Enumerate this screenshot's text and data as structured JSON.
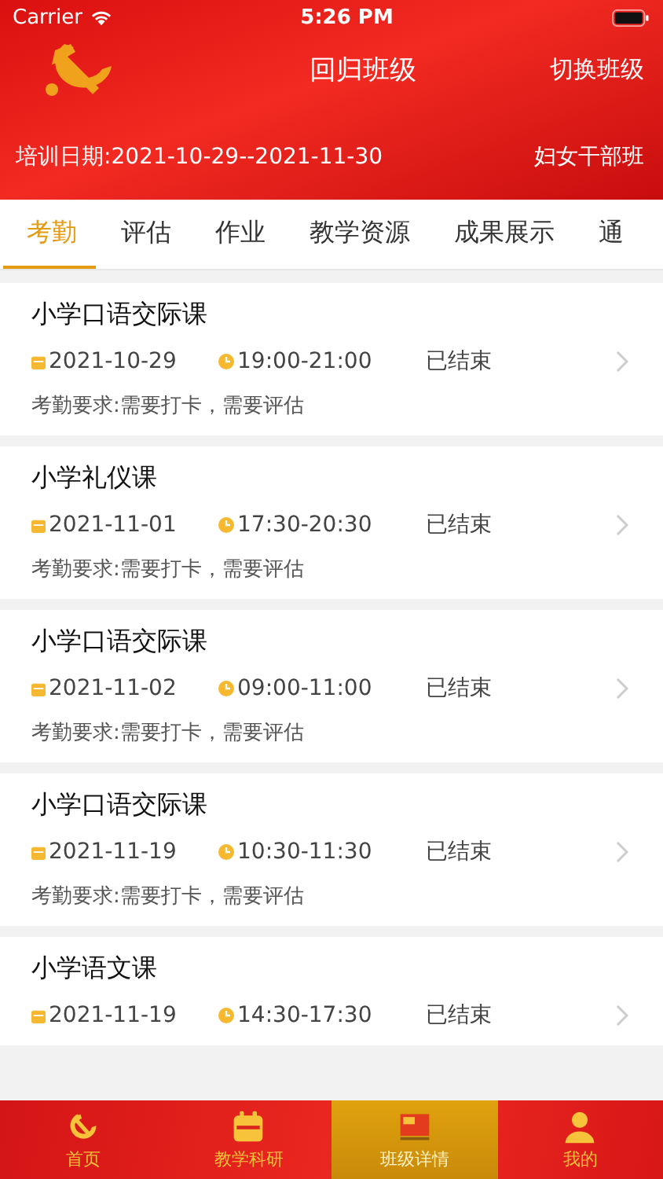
{
  "status_bar": {
    "carrier": "Carrier",
    "time": "5:26 PM"
  },
  "nav": {
    "title": "回归班级",
    "action": "切换班级"
  },
  "class_info": {
    "dates": "培训日期:2021-10-29--2021-11-30",
    "name": "妇女干部班"
  },
  "tabs": [
    {
      "label": "考勤",
      "selected": true
    },
    {
      "label": "评估",
      "selected": false
    },
    {
      "label": "作业",
      "selected": false
    },
    {
      "label": "教学资源",
      "selected": false
    },
    {
      "label": "成果展示",
      "selected": false
    },
    {
      "label": "通",
      "selected": false
    }
  ],
  "courses": [
    {
      "title": "小学口语交际课",
      "date": "2021-10-29",
      "time": "19:00-21:00",
      "status": "已结束",
      "requirement": "考勤要求:需要打卡，需要评估"
    },
    {
      "title": "小学礼仪课",
      "date": "2021-11-01",
      "time": "17:30-20:30",
      "status": "已结束",
      "requirement": "考勤要求:需要打卡，需要评估"
    },
    {
      "title": "小学口语交际课",
      "date": "2021-11-02",
      "time": "09:00-11:00",
      "status": "已结束",
      "requirement": "考勤要求:需要打卡，需要评估"
    },
    {
      "title": "小学口语交际课",
      "date": "2021-11-19",
      "time": "10:30-11:30",
      "status": "已结束",
      "requirement": "考勤要求:需要打卡，需要评估"
    },
    {
      "title": "小学语文课",
      "date": "2021-11-19",
      "time": "14:30-17:30",
      "status": "已结束"
    }
  ],
  "bottom_tabs": [
    {
      "kind": "home",
      "label": "首页",
      "selected": false
    },
    {
      "kind": "calendar",
      "label": "教学科研",
      "selected": false
    },
    {
      "kind": "screen",
      "label": "班级详情",
      "selected": true
    },
    {
      "kind": "person",
      "label": "我的",
      "selected": false
    }
  ]
}
